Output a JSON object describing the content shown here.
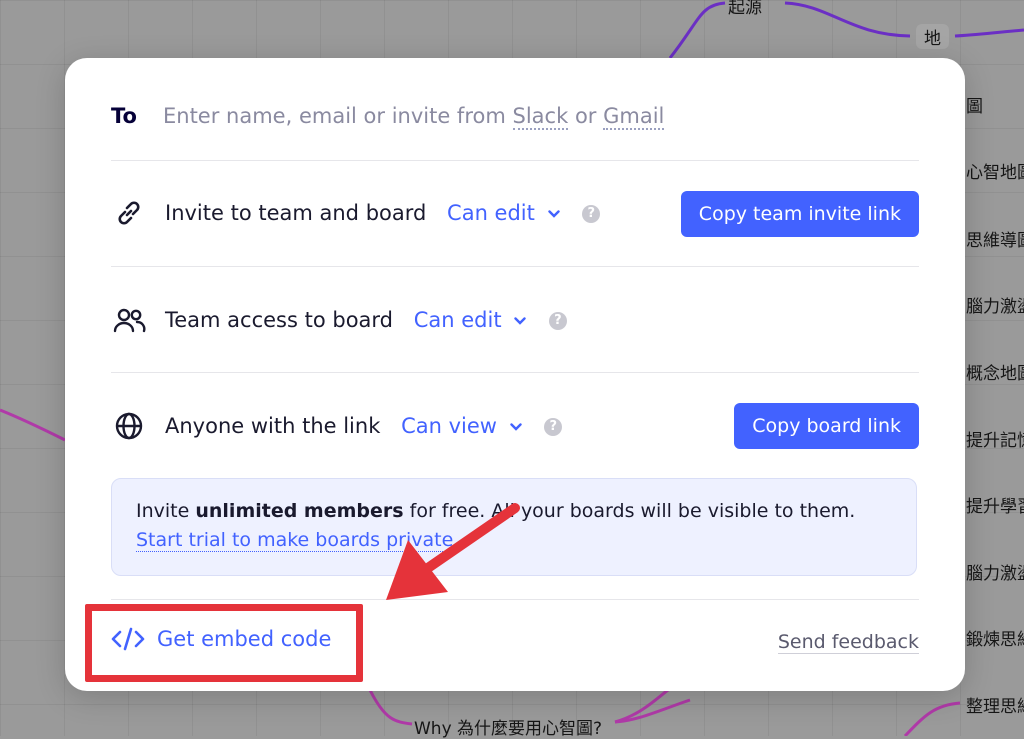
{
  "background_nodes": {
    "origin": "起源",
    "place": "地",
    "n1": "圖",
    "n2": "心智地圖",
    "n3": "思維導圖",
    "n4": "腦力激盪圖",
    "n5": "概念地圖",
    "n6": "提升記憶",
    "n7": "提升學習",
    "n8": "腦力激盪",
    "n9": "鍛煉思維",
    "n10": "整理思維",
    "why": "Why 為什麼要用心智圖?"
  },
  "invite": {
    "to_label": "To",
    "placeholder_prefix": "Enter name, email or invite from",
    "slack": "Slack",
    "or": "or",
    "gmail": "Gmail"
  },
  "permissions": [
    {
      "icon": "link-icon",
      "label": "Invite to team and board",
      "access": "Can edit",
      "button": "Copy team invite link"
    },
    {
      "icon": "team-icon",
      "label": "Team access to board",
      "access": "Can edit"
    },
    {
      "icon": "globe-icon",
      "label": "Anyone with the link",
      "access": "Can view",
      "button": "Copy board link"
    }
  ],
  "info": {
    "prefix": "Invite",
    "bold": "unlimited members",
    "rest": "for free. All your boards will be visible to them.",
    "link": "Start trial to make boards private."
  },
  "footer": {
    "embed_label": "Get embed code",
    "feedback_label": "Send feedback"
  },
  "colors": {
    "accent": "#4262ff",
    "annotation": "#e5333a",
    "info_bg": "#eef1ff"
  }
}
